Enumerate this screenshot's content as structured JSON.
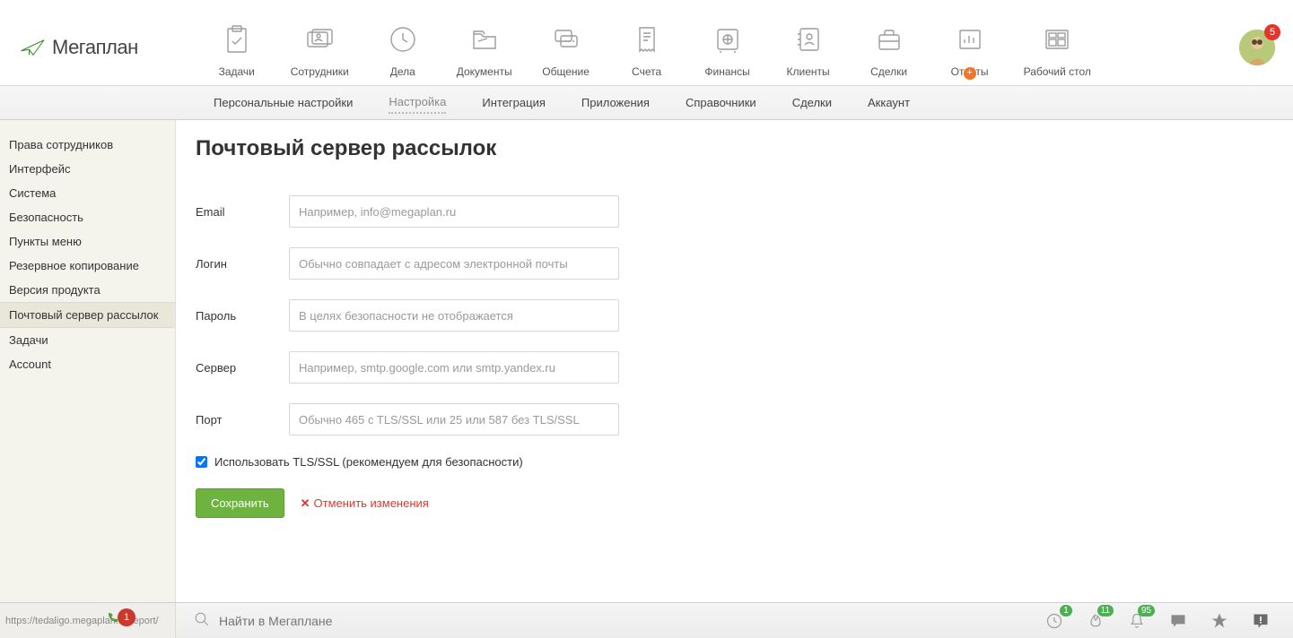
{
  "header": {
    "logo_text": "Мегаплан",
    "avatar_badge": "5",
    "nav": [
      {
        "label": "Задачи"
      },
      {
        "label": "Сотрудники"
      },
      {
        "label": "Дела"
      },
      {
        "label": "Документы"
      },
      {
        "label": "Общение"
      },
      {
        "label": "Счета"
      },
      {
        "label": "Финансы"
      },
      {
        "label": "Клиенты"
      },
      {
        "label": "Сделки"
      },
      {
        "label": "Отчёты",
        "plus": true
      },
      {
        "label": "Рабочий стол"
      }
    ]
  },
  "subtabs": {
    "items": [
      {
        "label": "Персональные настройки"
      },
      {
        "label": "Настройка",
        "active": true
      },
      {
        "label": "Интеграция"
      },
      {
        "label": "Приложения"
      },
      {
        "label": "Справочники"
      },
      {
        "label": "Сделки"
      },
      {
        "label": "Аккаунт"
      }
    ]
  },
  "sidebar": {
    "items": [
      {
        "label": "Права сотрудников"
      },
      {
        "label": "Интерфейс"
      },
      {
        "label": "Система"
      },
      {
        "label": "Безопасность"
      },
      {
        "label": "Пункты меню"
      },
      {
        "label": "Резервное копирование"
      },
      {
        "label": "Версия продукта"
      },
      {
        "label": "Почтовый сервер рассылок",
        "active": true
      },
      {
        "label": "Задачи"
      },
      {
        "label": "Account"
      }
    ]
  },
  "page": {
    "title": "Почтовый сервер рассылок",
    "email_label": "Email",
    "email_placeholder": "Например, info@megaplan.ru",
    "login_label": "Логин",
    "login_placeholder": "Обычно совпадает с адресом электронной почты",
    "password_label": "Пароль",
    "password_placeholder": "В целях безопасности не отображается",
    "server_label": "Сервер",
    "server_placeholder": "Например, smtp.google.com или smtp.yandex.ru",
    "port_label": "Порт",
    "port_placeholder": "Обычно 465 c TLS/SSL или 25 или 587 без TLS/SSL",
    "tls_label": "Использовать TLS/SSL (рекомендуем для безопасности)",
    "tls_checked": true,
    "save_label": "Сохранить",
    "cancel_label": "Отменить изменения"
  },
  "bottombar": {
    "url_preview": "https://tedaligo.megaplan.ru/report/",
    "phone_badge": "1",
    "search_placeholder": "Найти в Мегаплане",
    "clock_badge": "1",
    "fire_badge": "11",
    "bell_badge": "95"
  }
}
